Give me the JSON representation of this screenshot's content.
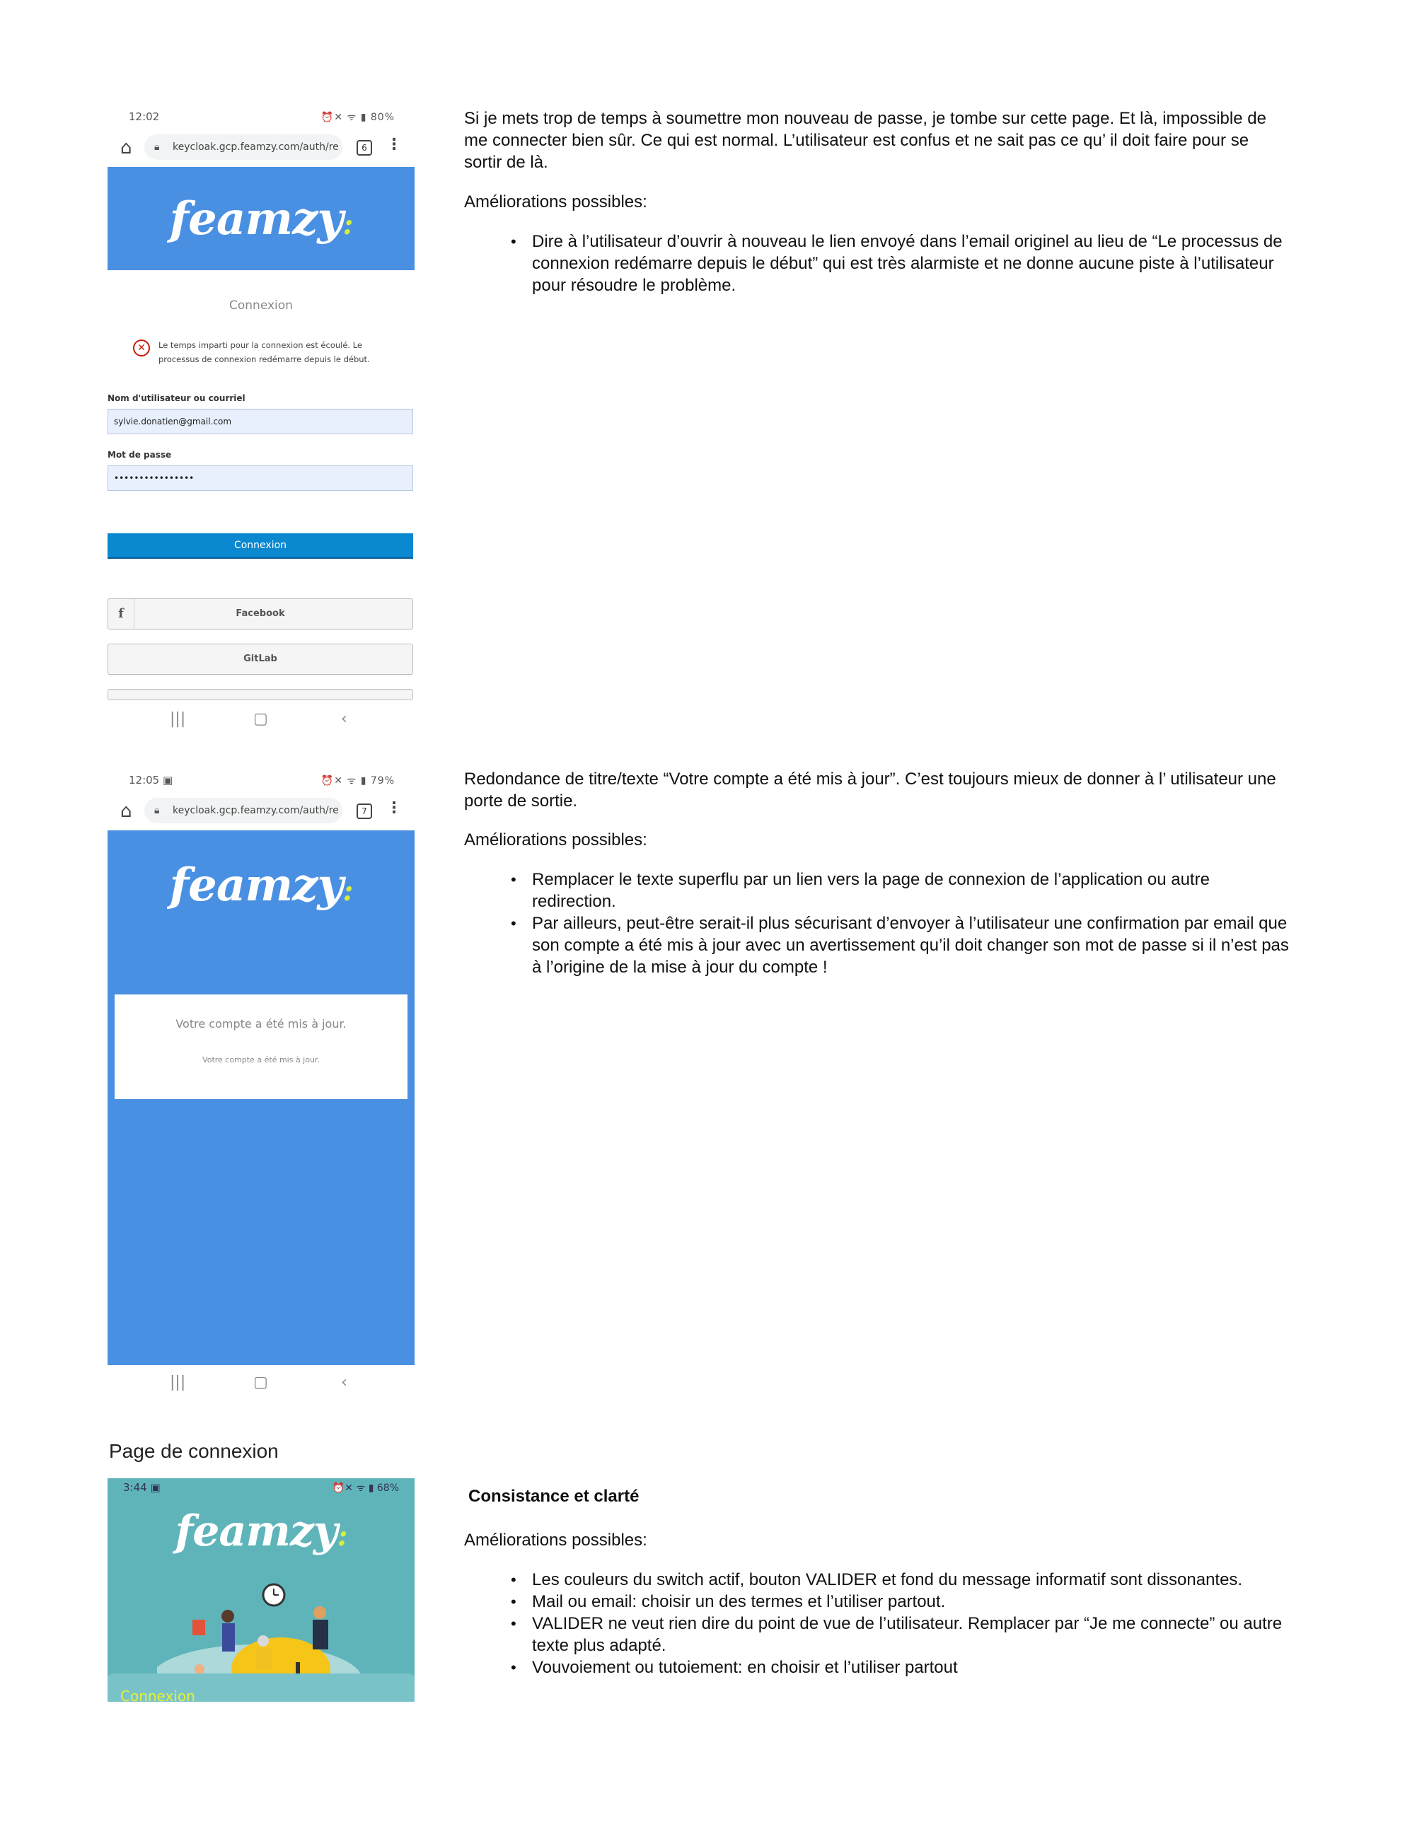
{
  "screen1": {
    "time": "12:02",
    "status": "80%",
    "url": "keycloak.gcp.feamzy.com/auth/re",
    "tab_count": "6",
    "logo": "feamzy",
    "title": "Connexion",
    "error": "Le temps imparti pour la connexion est écoulé. Le processus de connexion redémarre depuis le début.",
    "username_label": "Nom d'utilisateur ou courriel",
    "username_value": "sylvie.donatien@gmail.com",
    "password_label": "Mot de passe",
    "password_value": "••••••••••••••••",
    "login_button": "Connexion",
    "facebook_button": "Facebook",
    "gitlab_button": "GitLab",
    "facebook_icon": "f"
  },
  "screen2": {
    "time": "12:05",
    "status": "79%",
    "url": "keycloak.gcp.feamzy.com/auth/re",
    "tab_count": "7",
    "logo": "feamzy",
    "card_title": "Votre compte a été mis à jour.",
    "card_text": "Votre compte a été mis à jour."
  },
  "screen3": {
    "section_heading": "Page de connexion",
    "time": "3:44",
    "status": "68%",
    "logo": "feamzy",
    "bottom_label": "Connexion",
    "colors": {
      "background": "#5fb4ba",
      "accent": "#e6ef3a"
    }
  },
  "section1": {
    "paragraph": "Si je mets trop de temps à soumettre mon nouveau de passe, je tombe sur cette page. Et là, impossible de me connecter bien sûr. Ce qui est normal. L’utilisateur est confus et ne sait pas ce qu’ il doit faire pour se sortir de là.",
    "improvements_label": "Améliorations possibles:",
    "bullets": [
      "Dire à l’utilisateur d’ouvrir à nouveau le lien envoyé dans l’email originel au lieu de “Le processus de connexion redémarre depuis le début” qui est très alarmiste et ne donne aucune piste à l’utilisateur pour résoudre le problème."
    ]
  },
  "section2": {
    "paragraph": "Redondance de titre/texte “Votre compte a été mis à jour”. C’est toujours mieux de donner à l’ utilisateur une porte de sortie.",
    "improvements_label": "Améliorations possibles:",
    "bullets": [
      "Remplacer le texte superflu par un lien vers la page de connexion de l’application ou autre redirection.",
      "Par ailleurs, peut-être serait-il plus sécurisant d’envoyer à l’utilisateur une confirmation par email que son compte a été mis à jour avec un avertissement qu’il doit changer son mot de passe si il n’est pas à l’origine de la mise à jour du compte !"
    ]
  },
  "section3": {
    "heading": "Consistance et clarté",
    "improvements_label": "Améliorations possibles:",
    "bullets": [
      "Les couleurs du switch actif, bouton VALIDER et fond du message informatif sont dissonantes.",
      "Mail ou email: choisir un des termes et l’utiliser partout.",
      "VALIDER ne veut rien dire du point de vue de l’utilisateur. Remplacer par “Je me connecte” ou autre texte plus adapté.",
      "Vouvoiement ou tutoiement: en choisir et l’utiliser partout"
    ]
  }
}
